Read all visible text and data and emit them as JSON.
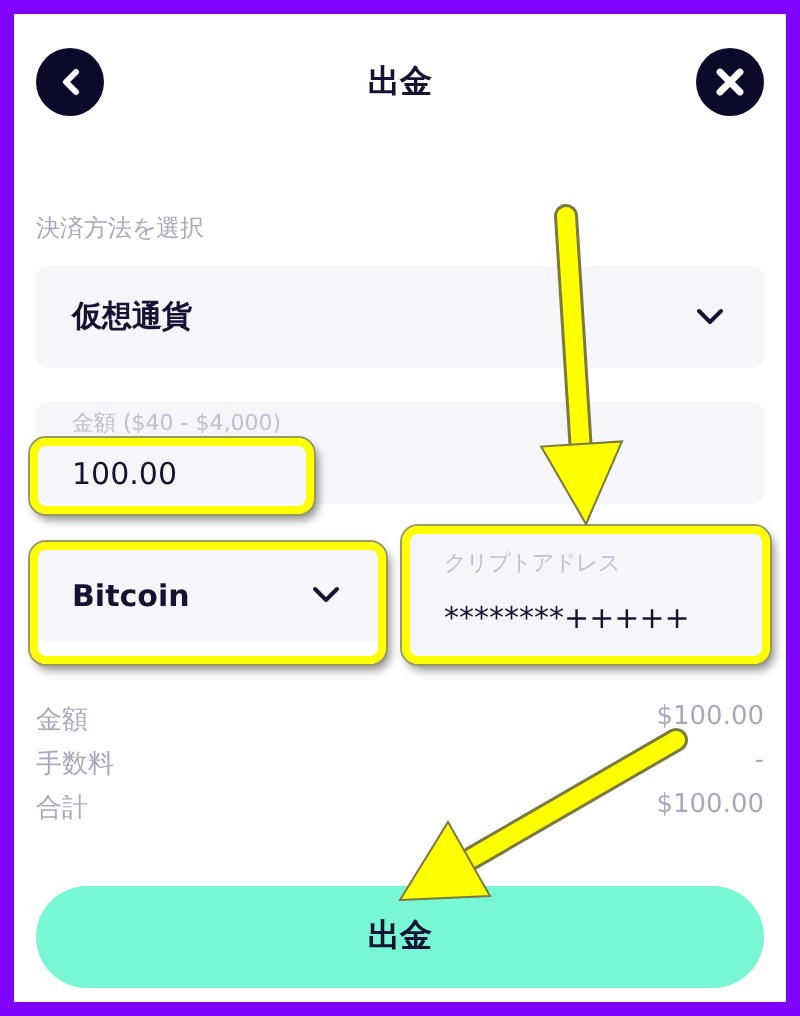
{
  "header": {
    "title": "出金"
  },
  "payment_method": {
    "label": "決済方法を選択",
    "value": "仮想通貨"
  },
  "amount": {
    "label": "金額 ($40 - $4,000)",
    "value": "100.00",
    "highlighted": true
  },
  "currency": {
    "value": "Bitcoin",
    "highlighted": true
  },
  "address": {
    "label": "クリプトアドレス",
    "value": "********+++++",
    "highlighted": true
  },
  "summary": [
    {
      "label": "金額",
      "value": "$100.00"
    },
    {
      "label": "手数料",
      "value": "-"
    },
    {
      "label": "合計",
      "value": "$100.00"
    }
  ],
  "submit": {
    "label": "出金"
  }
}
